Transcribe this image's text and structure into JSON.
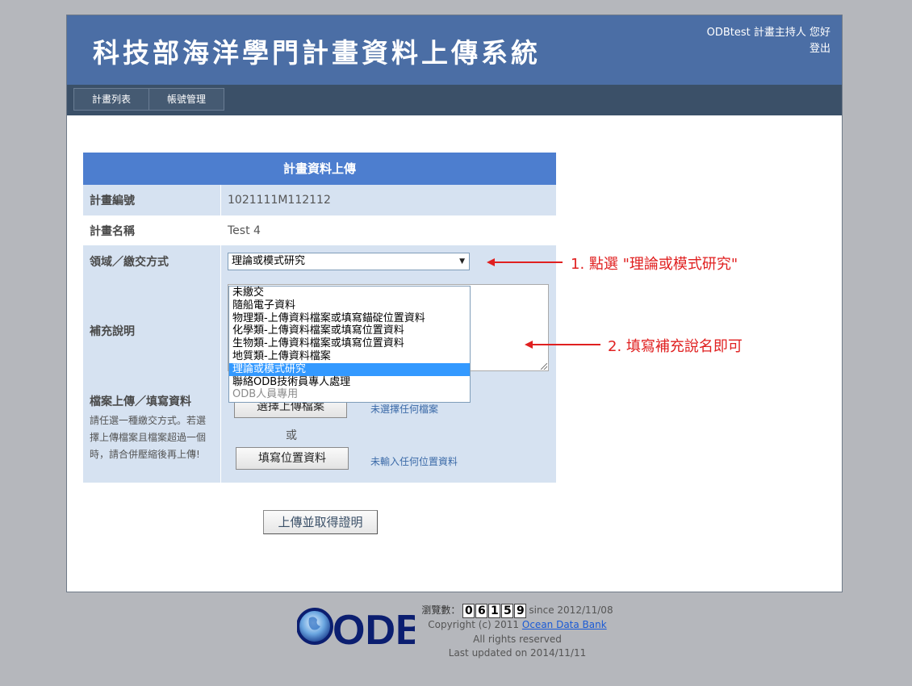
{
  "header": {
    "site_title": "科技部海洋學門計畫資料上傳系統",
    "user_greeting": "ODBtest 計畫主持人 您好",
    "logout_label": "登出"
  },
  "nav": {
    "items": [
      {
        "label": "計畫列表"
      },
      {
        "label": "帳號管理"
      }
    ]
  },
  "form": {
    "title": "計畫資料上傳",
    "project_id_label": "計畫編號",
    "project_id_value": "1021111M112112",
    "project_name_label": "計畫名稱",
    "project_name_value": "Test 4",
    "mode_label": "領域／繳交方式",
    "mode_selected": "理論或模式研究",
    "notes_label": "補充說明",
    "upload_label": "檔案上傳／填寫資料",
    "upload_note": "請任選一種繳交方式。若選擇上傳檔案且檔案超過一個時，請合併壓縮後再上傳!",
    "choose_file_label": "選擇上傳檔案",
    "or_label": "或",
    "fill_location_label": "填寫位置資料",
    "file_status": "未選擇任何檔案",
    "location_status": "未輸入任何位置資料",
    "submit_label": "上傳並取得證明"
  },
  "dropdown": {
    "options": [
      {
        "label": "未繳交"
      },
      {
        "label": "隨船電子資料"
      },
      {
        "label": "物理類-上傳資料檔案或填寫錨碇位置資料"
      },
      {
        "label": "化學類-上傳資料檔案或填寫位置資料"
      },
      {
        "label": "生物類-上傳資料檔案或填寫位置資料"
      },
      {
        "label": "地質類-上傳資料檔案"
      },
      {
        "label": "理論或模式研究"
      },
      {
        "label": "聯絡ODB技術員專人處理"
      },
      {
        "label": "ODB人員專用"
      }
    ],
    "selected_index": 6,
    "disabled_index": 8
  },
  "annotations": {
    "step1": "1. 點選 \"理論或模式研究\"",
    "step2": "2. 填寫補充說名即可",
    "color": "#e02020"
  },
  "footer": {
    "logo_text": "ODB",
    "counter_label": "瀏覽數：",
    "counter_digits": [
      "0",
      "6",
      "1",
      "5",
      "9"
    ],
    "since_text": "since 2012/11/08",
    "copyright_text": "Copyright (c) 2011",
    "link_text": "Ocean Data Bank",
    "rights_text": "All rights reserved",
    "updated_text": "Last updated on 2014/11/11"
  },
  "colors": {
    "header_bg": "#4b6ea5",
    "nav_bg": "#3b5068",
    "form_title_bg": "#4d7ecf",
    "row_blue": "#d6e2f1",
    "page_bg": "#b5b7bc"
  }
}
